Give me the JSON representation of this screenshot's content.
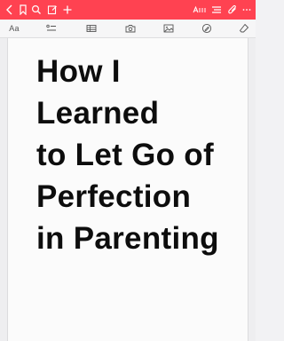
{
  "colors": {
    "brand_bar": "#ff4251",
    "toolbar_bg": "#f6f6f7",
    "page_bg": "#fbfbfb",
    "title_text": "#0d0d0d"
  },
  "top_bar": {
    "icons": [
      "back-icon",
      "bookmark-icon",
      "search-icon",
      "edit-icon",
      "add-icon",
      "text-style-icon",
      "list-icon",
      "attachment-icon",
      "more-icon"
    ]
  },
  "format_toolbar": {
    "font_label": "Aa",
    "icons": [
      "checklist-icon",
      "table-icon",
      "camera-icon",
      "image-icon",
      "pen-icon",
      "eraser-icon"
    ]
  },
  "note": {
    "title_lines": [
      "How I",
      "Learned",
      "to Let Go of",
      "Perfection",
      "in Parenting"
    ]
  }
}
